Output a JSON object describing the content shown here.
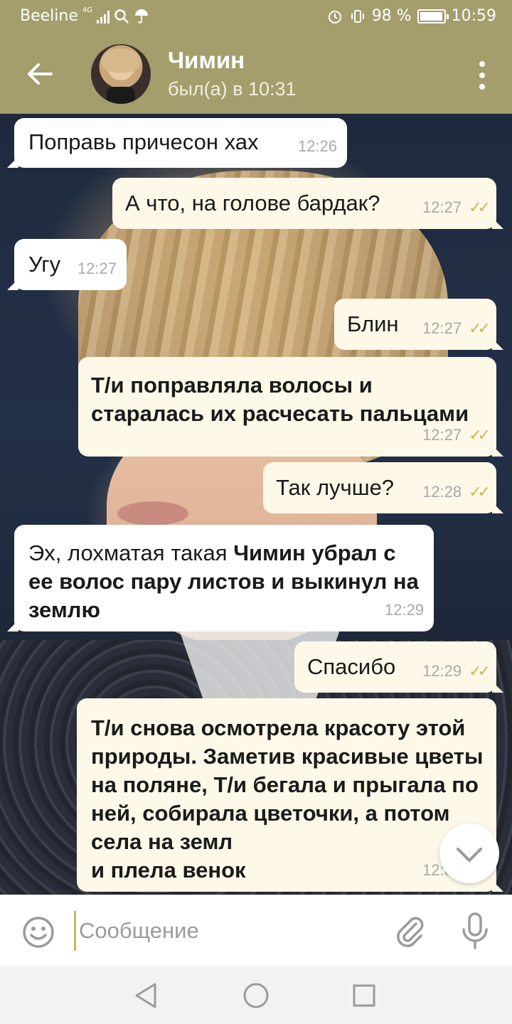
{
  "status_bar": {
    "carrier": "Beeline",
    "network": "4G",
    "battery": "98 %",
    "battery_level": 0.98,
    "time": "10:59"
  },
  "header": {
    "contact_name": "Чимин",
    "contact_status": "был(а) в 10:31"
  },
  "messages": [
    {
      "direction": "in",
      "text": "Поправь причесон хах",
      "time": "12:26"
    },
    {
      "direction": "out",
      "text": "А что, на голове бардак?",
      "time": "12:27",
      "read": true
    },
    {
      "direction": "in",
      "text": "Угу",
      "time": "12:27"
    },
    {
      "direction": "out",
      "text": "Блин",
      "time": "12:27",
      "read": true
    },
    {
      "direction": "out",
      "text": "Т/и поправляла волосы и старалась их расчесать пальцами",
      "time": "12:27",
      "read": true
    },
    {
      "direction": "out",
      "text": "Так лучше?",
      "time": "12:28",
      "read": true
    },
    {
      "direction": "in",
      "text_regular": "Эх, лохматая такая ",
      "text_bold": "Чимин убрал с ее волос пару листов и выкинул на землю",
      "time": "12:29"
    },
    {
      "direction": "out",
      "text": "Спасибо",
      "time": "12:29",
      "read": true
    },
    {
      "direction": "out",
      "text": "Т/и снова осмотрела красоту этой природы. Заметив красивые цветы на поляне, Т/и бегала и прыгала по ней, собирала цветочки, а потом села на земл",
      "text_tail": "и плела венок",
      "time": "12:30",
      "read": true
    }
  ],
  "composer": {
    "placeholder": "Сообщение"
  },
  "colors": {
    "header": "#a39e6c",
    "bubble_in": "#ffffff",
    "bubble_out": "#fdf8e8",
    "check": "#c6b85a"
  },
  "icons": {
    "back": "arrow-left-icon",
    "menu": "more-vertical-icon",
    "emoji": "smiley-icon",
    "attach": "paperclip-icon",
    "mic": "microphone-icon",
    "scroll": "chevron-down-icon"
  }
}
